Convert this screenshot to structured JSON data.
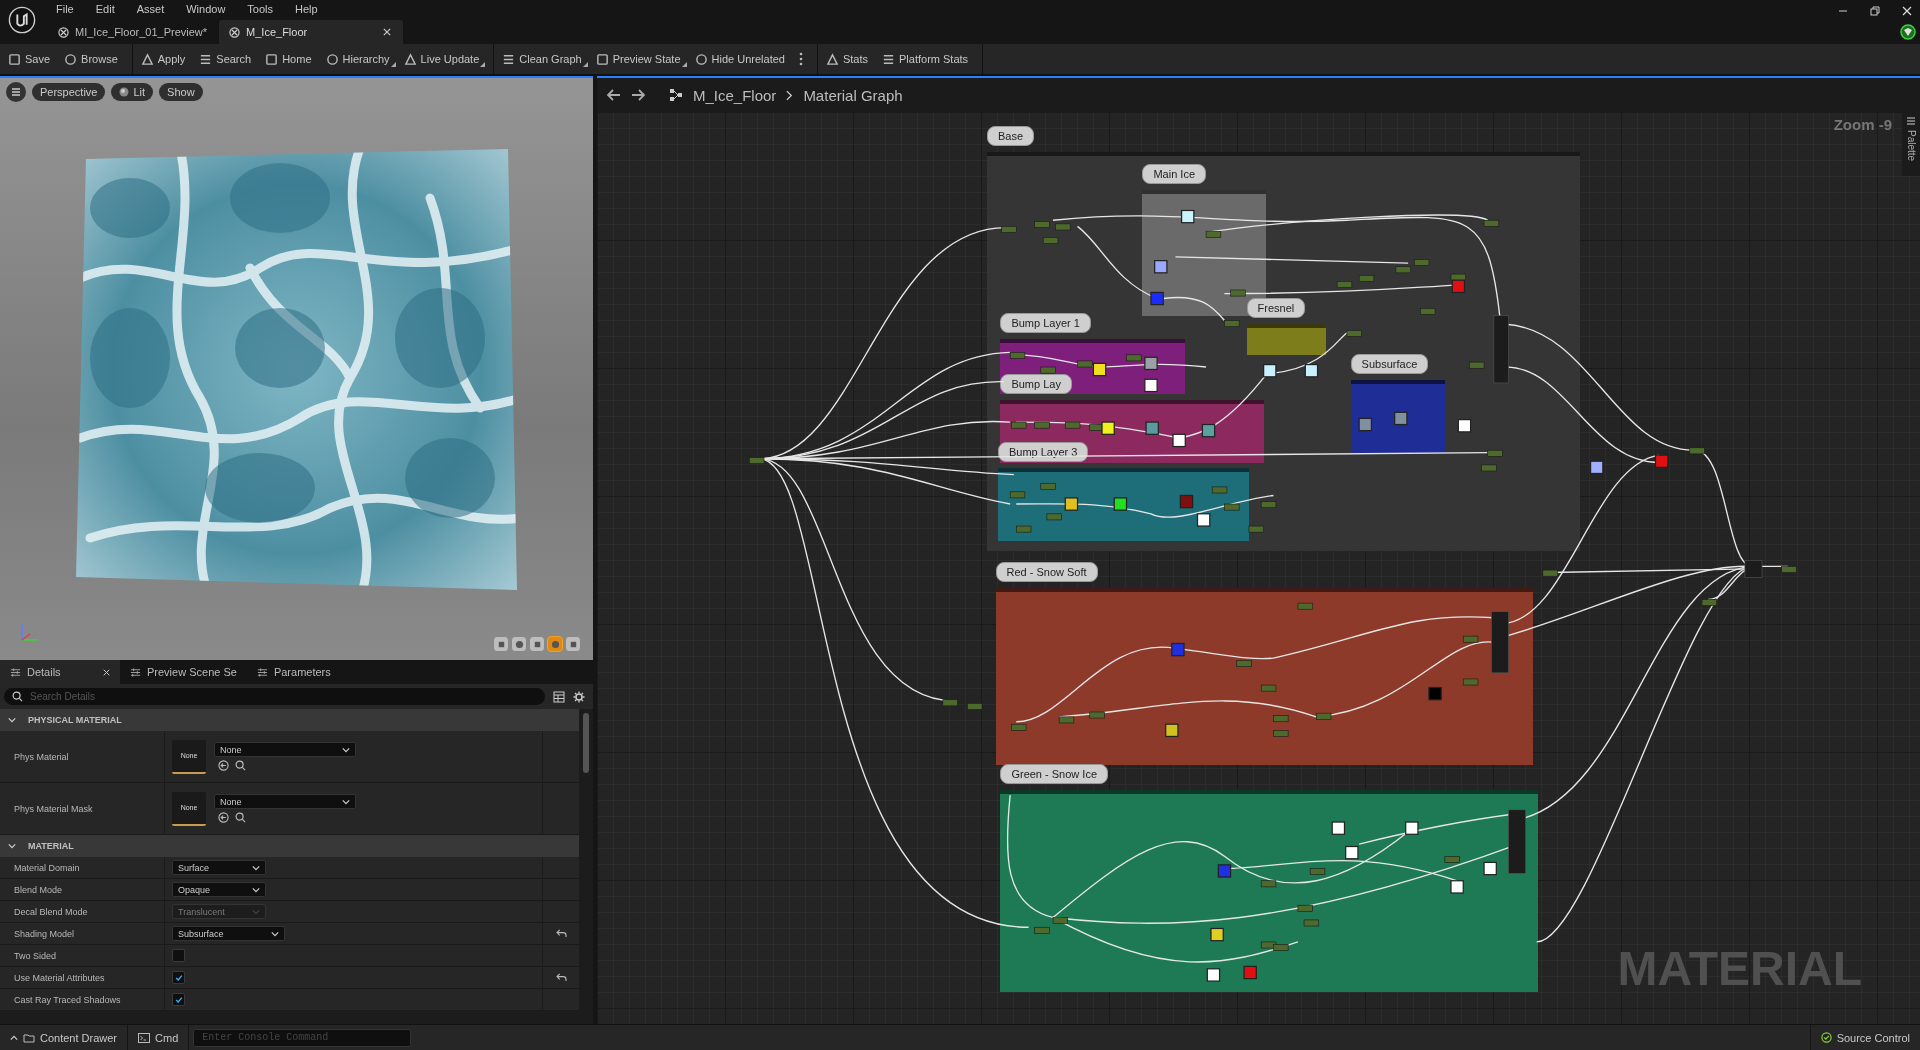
{
  "menu": [
    "File",
    "Edit",
    "Asset",
    "Window",
    "Tools",
    "Help"
  ],
  "tabs": [
    {
      "label": "MI_Ice_Floor_01_Preview*",
      "selected": false,
      "closable": false
    },
    {
      "label": "M_Ice_Floor",
      "selected": true,
      "closable": true
    }
  ],
  "toolbar": {
    "groups": [
      [
        {
          "kind": "button",
          "label": "Save",
          "dropdown": false
        },
        {
          "kind": "button",
          "label": "Browse",
          "dropdown": false
        }
      ],
      [
        {
          "kind": "button",
          "label": "Apply",
          "dropdown": false
        },
        {
          "kind": "button",
          "label": "Search",
          "dropdown": false
        },
        {
          "kind": "button",
          "label": "Home",
          "dropdown": false
        },
        {
          "kind": "button",
          "label": "Hierarchy",
          "dropdown": true
        },
        {
          "kind": "button",
          "label": "Live Update",
          "dropdown": true
        }
      ],
      [
        {
          "kind": "button",
          "label": "Clean Graph",
          "dropdown": true
        },
        {
          "kind": "button",
          "label": "Preview State",
          "dropdown": true
        },
        {
          "kind": "button",
          "label": "Hide Unrelated",
          "dropdown": false
        },
        {
          "kind": "overflow"
        }
      ],
      [
        {
          "kind": "button",
          "label": "Stats",
          "dropdown": false
        },
        {
          "kind": "button",
          "label": "Platform Stats",
          "dropdown": false
        }
      ]
    ]
  },
  "viewport": {
    "buttons": [
      "Perspective",
      "Lit",
      "Show"
    ],
    "preview_meshes": [
      {
        "selected": false
      },
      {
        "selected": false
      },
      {
        "selected": false
      },
      {
        "selected": true
      },
      {
        "selected": false
      }
    ]
  },
  "details": {
    "tabs": [
      {
        "label": "Details",
        "selected": true,
        "closable": true
      },
      {
        "label": "Preview Scene Se",
        "selected": false,
        "closable": false
      },
      {
        "label": "Parameters",
        "selected": false,
        "closable": false
      }
    ],
    "search": {
      "placeholder": "Search Details"
    },
    "sections": [
      {
        "title": "PHYSICAL MATERIAL",
        "expanded": true,
        "rows": [
          {
            "kind": "asset",
            "label": "Phys Material",
            "thumbnail": "None",
            "value": "None"
          },
          {
            "kind": "asset",
            "label": "Phys Material Mask",
            "thumbnail": "None",
            "value": "None"
          }
        ]
      },
      {
        "title": "MATERIAL",
        "expanded": true,
        "rows": [
          {
            "kind": "dropdown",
            "label": "Material Domain",
            "value": "Surface",
            "disabled": false,
            "modified": false
          },
          {
            "kind": "dropdown",
            "label": "Blend Mode",
            "value": "Opaque",
            "disabled": false,
            "modified": false
          },
          {
            "kind": "dropdown",
            "label": "Decal Blend Mode",
            "value": "Translucent",
            "disabled": true,
            "modified": false
          },
          {
            "kind": "dropdown",
            "label": "Shading Model",
            "value": "Subsurface",
            "disabled": false,
            "modified": true
          },
          {
            "kind": "checkbox",
            "label": "Two Sided",
            "checked": false,
            "modified": false
          },
          {
            "kind": "checkbox",
            "label": "Use Material Attributes",
            "checked": true,
            "modified": true
          },
          {
            "kind": "checkbox",
            "label": "Cast Ray Traced Shadows",
            "checked": true,
            "modified": false
          }
        ]
      }
    ]
  },
  "graph": {
    "breadcrumb": [
      "M_Ice_Floor",
      "Material Graph"
    ],
    "zoom": "Zoom -9",
    "palette": "Palette",
    "watermark": "MATERIAL",
    "comments": [
      {
        "title": "Base",
        "color": "#353535"
      },
      {
        "title": "Main Ice",
        "color": "#6a6a6a"
      },
      {
        "title": "Bump Layer 1",
        "color": "#7e1f7c"
      },
      {
        "title": "Bump Lay",
        "color": "#8c2a60"
      },
      {
        "title": "Bump Layer 3",
        "color": "#1d6e78"
      },
      {
        "title": "Fresnel",
        "color": "#7d7d1c"
      },
      {
        "title": "Subsurface",
        "color": "#1e2e96"
      },
      {
        "title": "Red - Snow Soft",
        "color": "#8e3a2a"
      },
      {
        "title": "Green - Snow Ice",
        "color": "#1d7a55"
      }
    ]
  },
  "status_bar": {
    "content_drawer": "Content Drawer",
    "cmd": "Cmd",
    "console_placeholder": "Enter Console Command",
    "source_control": "Source Control"
  }
}
